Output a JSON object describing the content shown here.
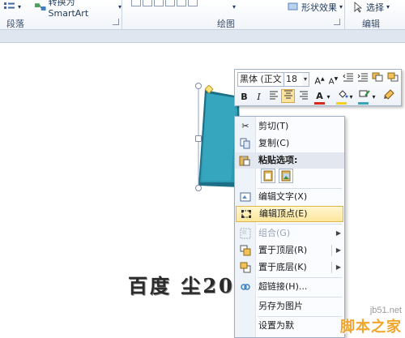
{
  "ribbon": {
    "smartart_label": "转换为 SmartArt",
    "shape_effects_label": "形状效果",
    "select_label": "选择",
    "groups": [
      "段落",
      "绘图",
      "编辑"
    ]
  },
  "slide_text": "百度 尘2011",
  "minibar": {
    "font_name": "黑体 (正文",
    "font_size": "18",
    "bold": "B",
    "italic": "I",
    "font_color": "#d42a1a",
    "highlight_color": "#f0d020"
  },
  "context_menu": {
    "items": [
      {
        "label": "剪切(T)",
        "icon": "scissors-icon"
      },
      {
        "label": "复制(C)",
        "icon": "copy-icon"
      },
      {
        "label": "粘贴选项:",
        "icon": "paste-icon"
      },
      {
        "label": "编辑文字(X)",
        "icon": "edit-text-icon"
      },
      {
        "label": "编辑顶点(E)",
        "icon": "edit-points-icon"
      },
      {
        "label": "组合(G)",
        "icon": "group-icon"
      },
      {
        "label": "置于顶层(R)",
        "icon": "bring-to-front-icon"
      },
      {
        "label": "置于底层(K)",
        "icon": "send-to-back-icon"
      },
      {
        "label": "超链接(H)...",
        "icon": "hyperlink-icon"
      },
      {
        "label": "另存为图片",
        "icon": "save-as-picture-icon"
      },
      {
        "label": "设置为默",
        "icon": "set-default-icon"
      }
    ]
  },
  "watermark": {
    "url": "jb51.net",
    "name": "脚本之家"
  },
  "colors": {
    "shape_fill": "#2f9ab2",
    "shape_dark": "#1c6f86",
    "menu_highlight": "#fde79d"
  }
}
